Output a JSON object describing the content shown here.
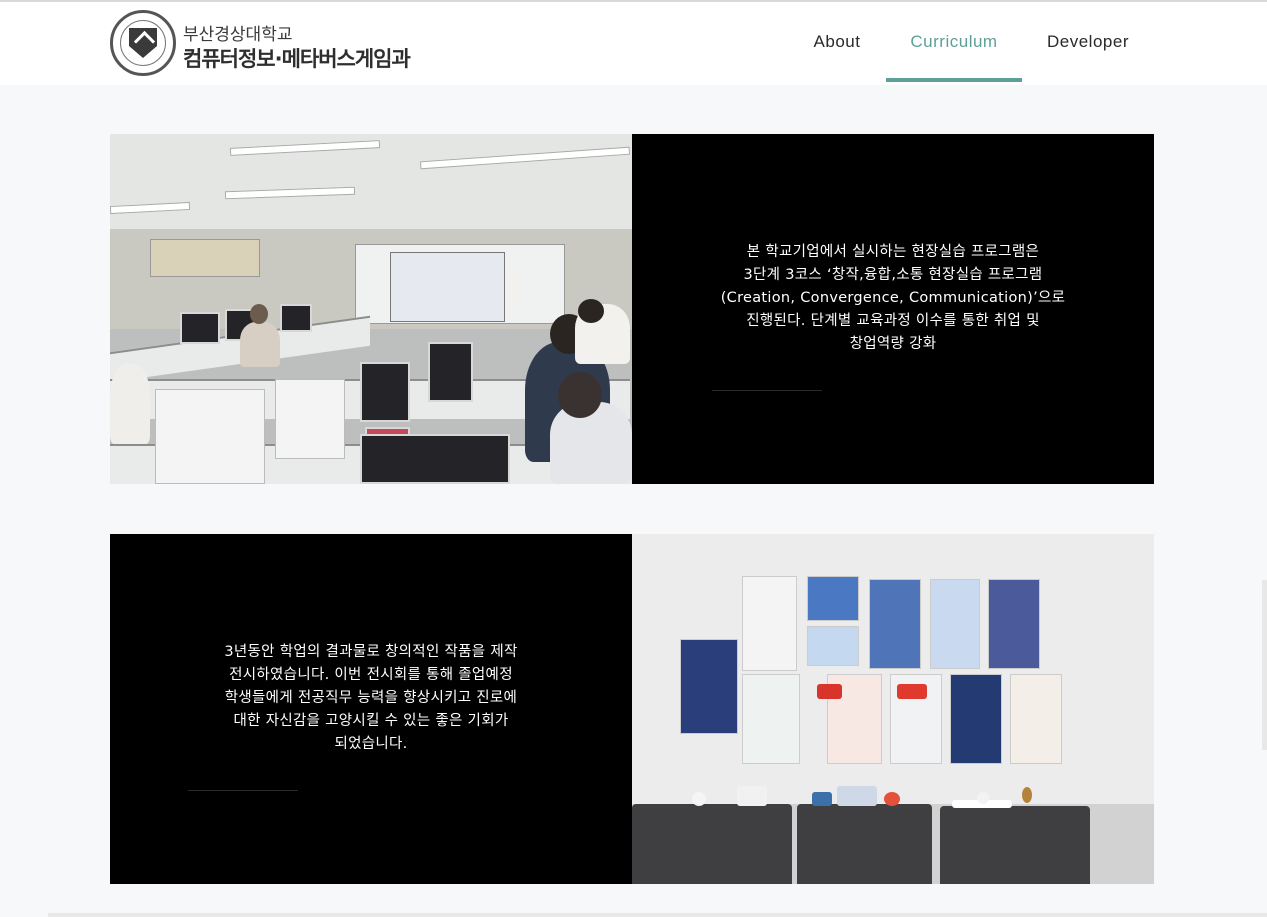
{
  "header": {
    "logo_line1": "부산경상대학교",
    "logo_line2": "컴퓨터정보·메타버스게임과",
    "nav": [
      {
        "label": "About",
        "active": false
      },
      {
        "label": "Curriculum",
        "active": true
      },
      {
        "label": "Developer",
        "active": false
      }
    ]
  },
  "colors": {
    "accent": "#5f9f99",
    "panel_bg": "#000000",
    "page_bg": "#f7f8fa"
  },
  "sections": [
    {
      "image": "classroom-photo",
      "text": "본 학교기업에서 실시하는 현장실습 프로그램은\n3단계 3코스 ‘창작,융합,소통 현장실습 프로그램\n(Creation, Convergence, Communication)’으로\n진행된다. 단계별 교육과정 이수를 통한 취업 및\n창업역량 강화"
    },
    {
      "image": "exhibition-photo",
      "text": "3년동안 학업의 결과물로 창의적인 작품을 제작\n전시하였습니다. 이번 전시회를 통해 졸업예정\n학생들에게 전공직무 능력을 향상시키고 진로에\n대한 자신감을 고양시킬 수 있는 좋은 기회가\n되었습니다."
    }
  ]
}
